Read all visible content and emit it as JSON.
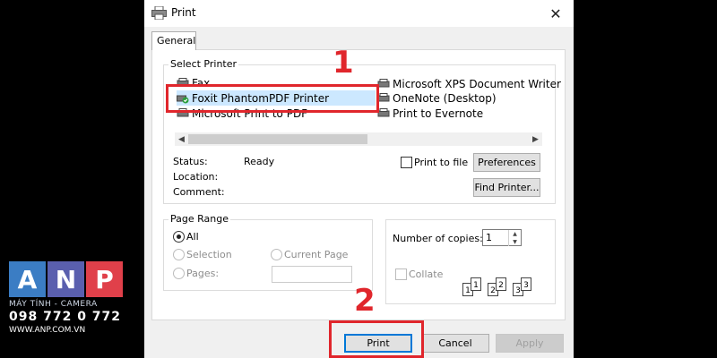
{
  "watermark": {
    "letters": [
      "A",
      "N",
      "P"
    ],
    "tagline": "MÁY TÍNH - CAMERA",
    "phone": "098 772 0 772",
    "website": "WWW.ANP.COM.VN"
  },
  "window": {
    "title": "Print",
    "close_glyph": "✕"
  },
  "tabs": [
    {
      "label": "General"
    }
  ],
  "select_printer": {
    "group_label": "Select Printer",
    "printers_left": [
      {
        "name": "Fax",
        "icon": "fax-printer-icon"
      },
      {
        "name": "Foxit PhantomPDF Printer",
        "icon": "default-printer-icon",
        "selected": true
      },
      {
        "name": "Microsoft Print to PDF",
        "icon": "printer-icon"
      }
    ],
    "printers_right": [
      {
        "name": "Microsoft XPS Document Writer",
        "icon": "printer-icon"
      },
      {
        "name": "OneNote (Desktop)",
        "icon": "printer-icon"
      },
      {
        "name": "Print to Evernote",
        "icon": "printer-icon"
      }
    ],
    "status_label": "Status:",
    "status_value": "Ready",
    "location_label": "Location:",
    "comment_label": "Comment:",
    "print_to_file_label": "Print to file",
    "preferences_label": "Preferences",
    "find_printer_label": "Find Printer..."
  },
  "page_range": {
    "group_label": "Page Range",
    "all_label": "All",
    "selection_label": "Selection",
    "current_page_label": "Current Page",
    "pages_label": "Pages:"
  },
  "copies": {
    "number_label": "Number of copies:",
    "value": "1",
    "collate_label": "Collate",
    "collate_pages": [
      "1",
      "1",
      "2",
      "2",
      "3",
      "3"
    ]
  },
  "buttons": {
    "print": "Print",
    "cancel": "Cancel",
    "apply": "Apply"
  },
  "annotations": {
    "step1": "1",
    "step2": "2"
  },
  "colors": {
    "highlight_red": "#e0262c",
    "selection_blue": "#cce8ff",
    "default_button_border": "#0078d7"
  }
}
